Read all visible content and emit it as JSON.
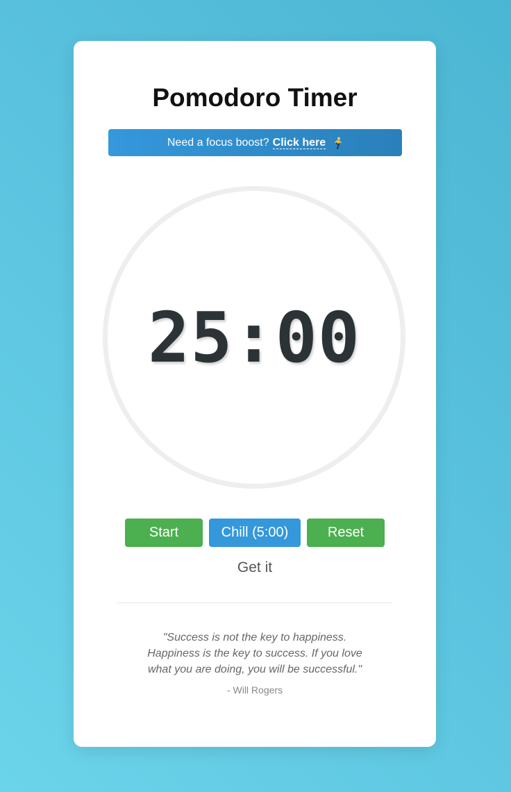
{
  "app": {
    "title": "Pomodoro Timer"
  },
  "banner": {
    "prefix": "Need a focus boost?",
    "link_label": "Click here",
    "icon": "person-running-icon",
    "color_start": "#3498db",
    "color_end": "#2a80ba"
  },
  "timer": {
    "display": "25:00"
  },
  "controls": {
    "start_label": "Start",
    "chill_label": "Chill (5:00)",
    "reset_label": "Reset",
    "get_it_label": "Get it"
  },
  "quote": {
    "text": "\"Success is not the key to happiness. Happiness is the key to success. If you love what you are doing, you will be successful.\"",
    "author": "- Will Rogers"
  },
  "colors": {
    "accent_green": "#4caf50",
    "accent_blue": "#3498db",
    "timer_text": "#2c3336"
  }
}
